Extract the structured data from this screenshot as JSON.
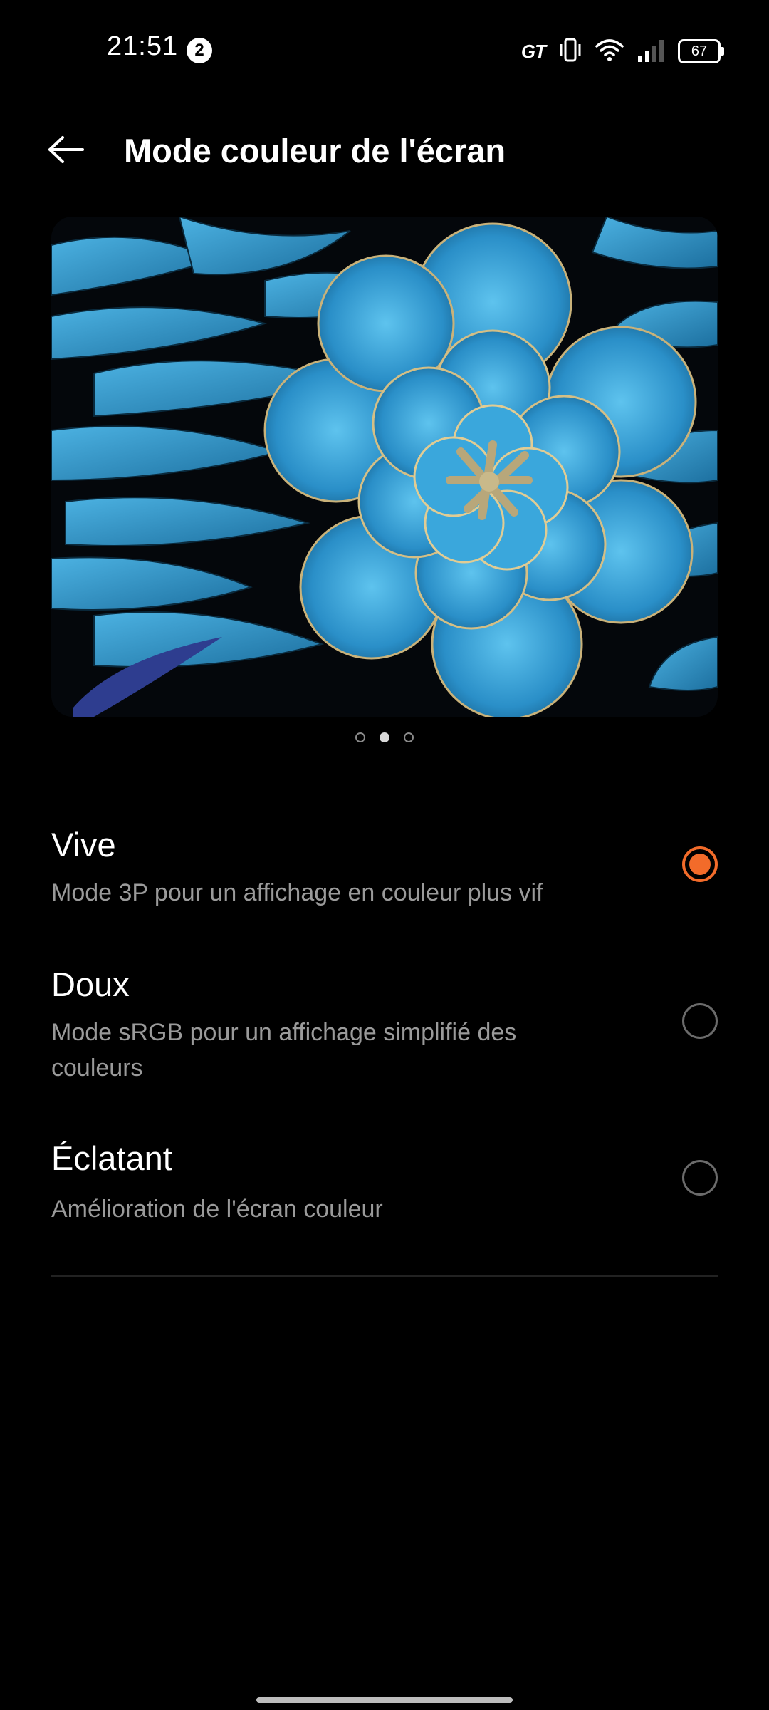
{
  "status_bar": {
    "time": "21:51",
    "notification_count": "2",
    "network_label": "GT",
    "battery": "67",
    "icons": [
      "gt-mode-icon",
      "vibrate-icon",
      "wifi-icon",
      "signal-icon",
      "battery-icon"
    ]
  },
  "header": {
    "back_icon": "back-arrow-icon",
    "title": "Mode couleur de l'écran"
  },
  "preview": {
    "image_subject": "blue-feather-flower-image",
    "pages": 3,
    "active_page": 2
  },
  "options": [
    {
      "title": "Vive",
      "description": "Mode 3P pour un affichage en couleur plus vif",
      "selected": true
    },
    {
      "title": "Doux",
      "description": "Mode sRGB pour un affichage simplifié des couleurs",
      "selected": false
    },
    {
      "title": "Éclatant",
      "description": "Amélioration de l'écran couleur",
      "selected": false
    }
  ],
  "colors": {
    "background": "#000000",
    "accent": "#f26b2a",
    "primary_text": "#ffffff",
    "secondary_text": "#9a9a9a"
  }
}
